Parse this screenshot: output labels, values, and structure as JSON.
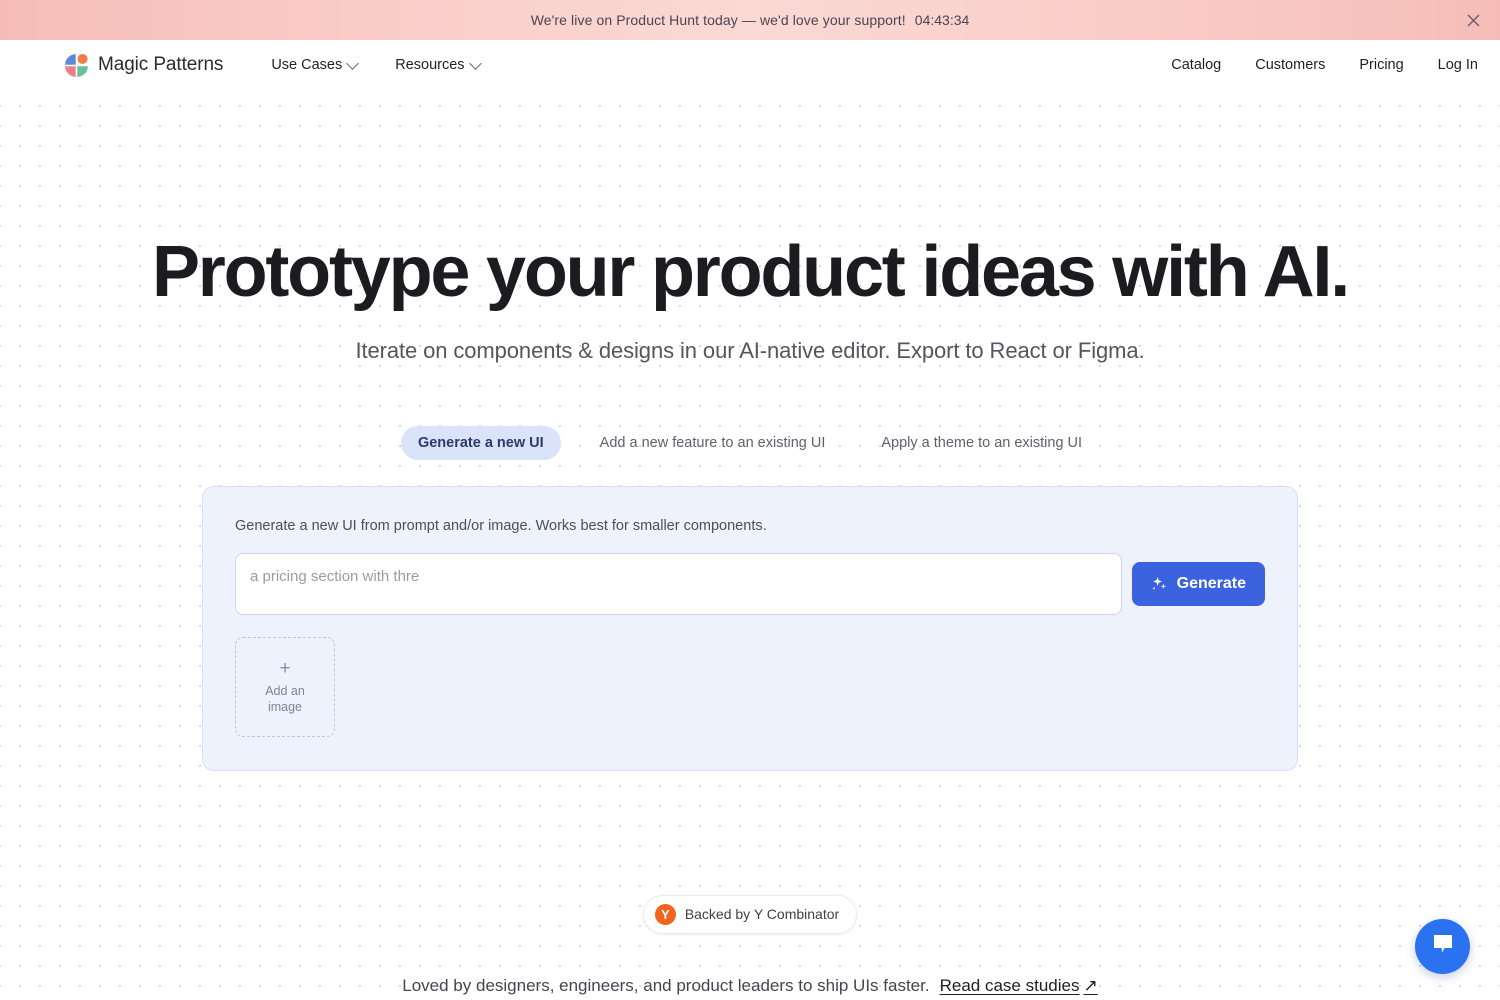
{
  "announcement": {
    "message": "We're live on Product Hunt today — we'd love your support!",
    "timer": "04:43:34",
    "close_icon": "close-icon",
    "background_color": "#f7c4bf"
  },
  "header": {
    "brand": {
      "name": "Magic Patterns",
      "logo_icon": "magic-patterns-logo-icon",
      "logo_colors": [
        "#4f7fd6",
        "#f0713a",
        "#e4727f",
        "#56b98e"
      ]
    },
    "nav_left": [
      {
        "label": "Use Cases",
        "has_dropdown": true
      },
      {
        "label": "Resources",
        "has_dropdown": true
      }
    ],
    "nav_right": [
      {
        "label": "Catalog"
      },
      {
        "label": "Customers"
      },
      {
        "label": "Pricing"
      },
      {
        "label": "Log In"
      }
    ]
  },
  "hero": {
    "headline": "Prototype your product ideas with AI.",
    "subheadline": "Iterate on components & designs in our AI-native editor. Export to React or Figma."
  },
  "tabs": [
    {
      "label": "Generate a new UI",
      "active": true
    },
    {
      "label": "Add a new feature to an existing UI",
      "active": false
    },
    {
      "label": "Apply a theme to an existing UI",
      "active": false
    }
  ],
  "generator": {
    "description": "Generate a new UI from prompt and/or image. Works best for smaller components.",
    "prompt_placeholder": "a pricing section with thre",
    "prompt_value": "",
    "generate_button": {
      "label": "Generate",
      "icon": "sparkles-icon",
      "color": "#3b63e0"
    },
    "add_image": {
      "plus_icon": "plus-icon",
      "line1": "Add an",
      "line2": "image"
    },
    "panel_background": "#eef2fd",
    "active_tab_background": "#dbe3fb"
  },
  "yc_badge": {
    "mark": "Y",
    "label": "Backed by Y Combinator",
    "mark_color": "#f2641e"
  },
  "footer": {
    "tagline": "Loved by designers, engineers, and product leaders to ship UIs faster.",
    "link_label": "Read case studies",
    "link_arrow": "↗"
  },
  "chat_widget": {
    "icon": "chat-bubble-icon",
    "color": "#2a72f0"
  }
}
